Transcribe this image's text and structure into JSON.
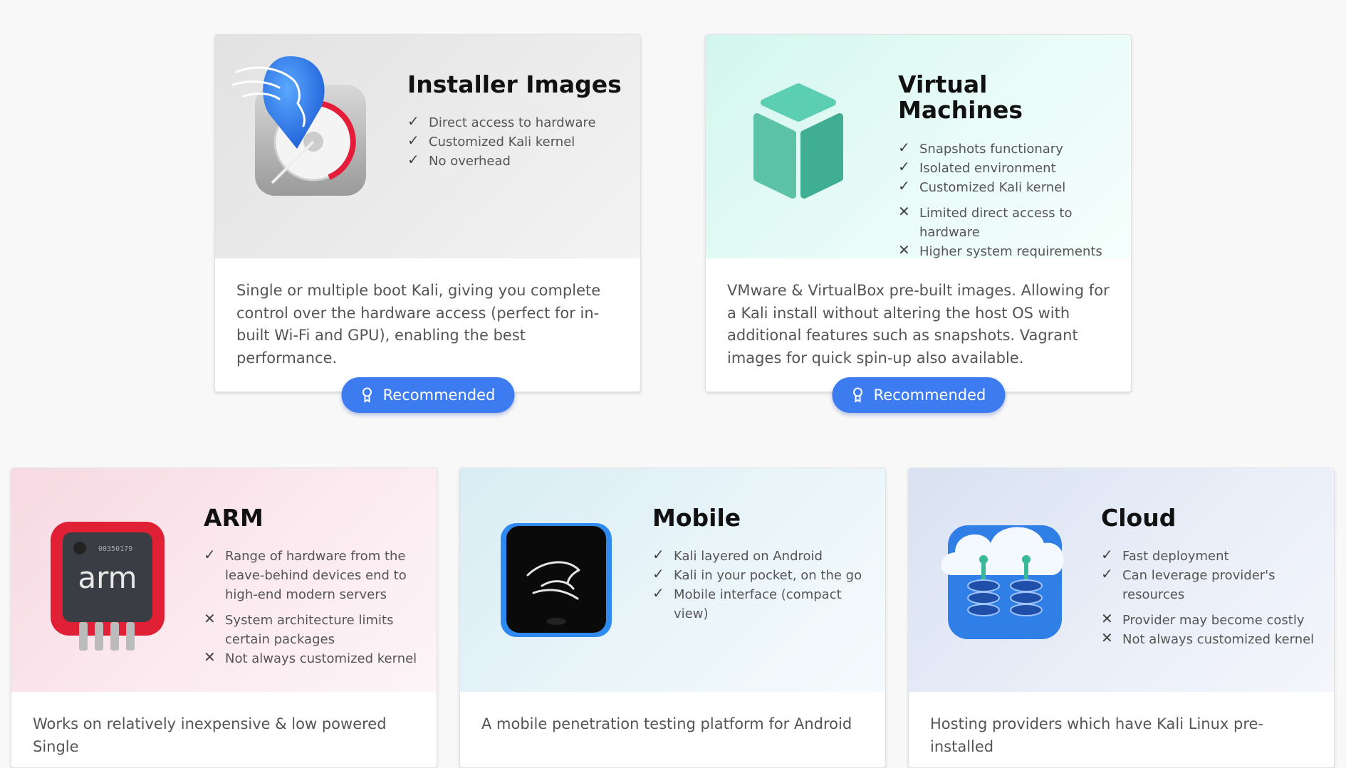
{
  "recommended_label": "Recommended",
  "cards": [
    {
      "title": "Installer Images",
      "icon": "hard-drive-dragon-icon",
      "pros": [
        "Direct access to hardware",
        "Customized Kali kernel",
        "No overhead"
      ],
      "cons": [],
      "description": "Single or multiple boot Kali, giving you complete control over the hardware access (perfect for in-built Wi-Fi and GPU), enabling the best performance."
    },
    {
      "title": "Virtual Machines",
      "icon": "cube-icon",
      "pros": [
        "Snapshots functionary",
        "Isolated environment",
        "Customized Kali kernel"
      ],
      "cons": [
        "Limited direct access to hardware",
        "Higher system requirements"
      ],
      "description": "VMware & VirtualBox pre-built images. Allowing for a Kali install without altering the host OS with additional features such as snapshots. Vagrant images for quick spin-up also available."
    },
    {
      "title": "ARM",
      "icon": "arm-chip-icon",
      "chip_label": "arm",
      "chip_serial": "00350179",
      "pros": [
        "Range of hardware from the leave-behind devices end to high-end modern servers"
      ],
      "cons": [
        "System architecture limits certain packages",
        "Not always customized kernel"
      ],
      "description": "Works on relatively inexpensive & low powered Single"
    },
    {
      "title": "Mobile",
      "icon": "phone-dragon-icon",
      "pros": [
        "Kali layered on Android",
        "Kali in your pocket, on the go",
        "Mobile interface (compact view)"
      ],
      "cons": [],
      "description": "A mobile penetration testing platform for Android"
    },
    {
      "title": "Cloud",
      "icon": "cloud-database-icon",
      "pros": [
        "Fast deployment",
        "Can leverage provider's resources"
      ],
      "cons": [
        "Provider may become costly",
        "Not always customized kernel"
      ],
      "description": "Hosting providers which have Kali Linux pre-installed"
    }
  ],
  "colors": {
    "accent": "#3d7bf0",
    "page_bg": "#f8f8f8",
    "vm_cube": "#4cbfa4",
    "arm_red": "#e02034",
    "cloud_blue": "#2f7fe6"
  }
}
